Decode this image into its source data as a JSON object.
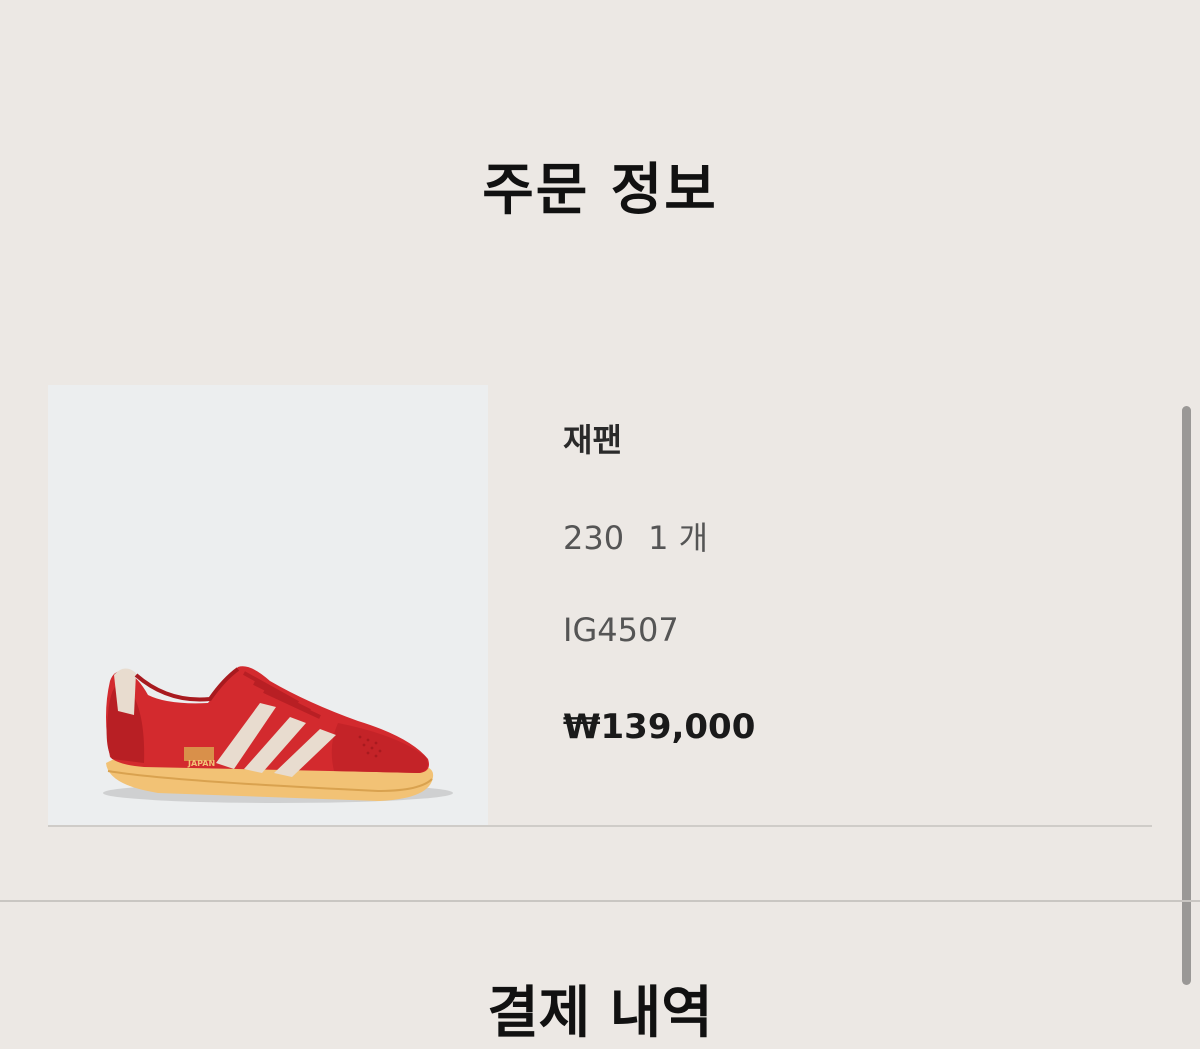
{
  "header": {
    "title": "주문 정보"
  },
  "order_item": {
    "product_name": "재팬",
    "size": "230",
    "quantity": "1 개",
    "product_code": "IG4507",
    "price": "₩139,000",
    "image_icon": "sneaker-image",
    "shoe_logo_text": "JAPAN",
    "colors": {
      "shoe_red": "#d32a2e",
      "stripe_cream": "#e8dccf",
      "sole_gum": "#f2c275"
    }
  },
  "next_section": {
    "title": "결제 내역"
  }
}
